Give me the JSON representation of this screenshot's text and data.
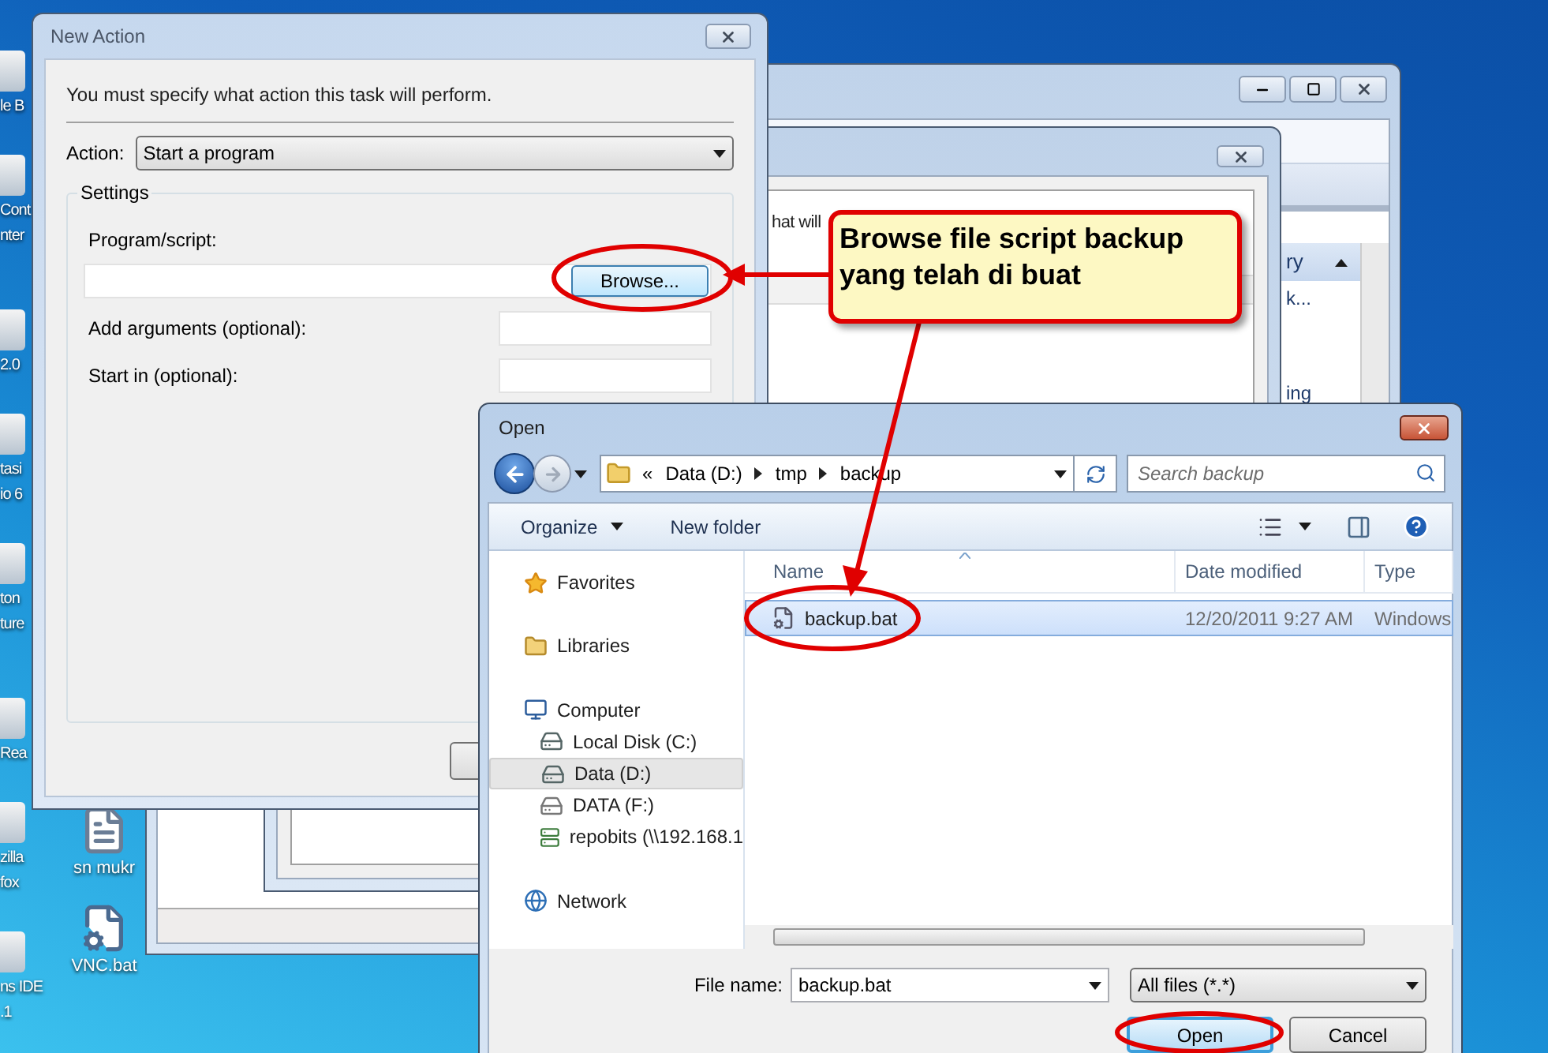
{
  "desktop": {
    "icons_left": [
      {
        "lines": [
          "le B"
        ]
      },
      {
        "lines": [
          "Cont",
          "nter"
        ]
      },
      {
        "lines": [
          "2.0"
        ]
      },
      {
        "lines": [
          "tasi",
          "io 6"
        ]
      },
      {
        "lines": [
          "ton",
          "ture"
        ]
      },
      {
        "lines": [
          "Rea"
        ]
      },
      {
        "lines": [
          "zilla",
          "fox"
        ]
      },
      {
        "lines": [
          "ns IDE",
          ".1"
        ]
      }
    ],
    "icons_right": [
      {
        "label": "sn mukr",
        "kind": "document"
      },
      {
        "label": "VNC.bat",
        "kind": "shortcut"
      }
    ]
  },
  "back_window": {
    "pane_header": "ry",
    "pane_items": [
      "k...",
      "ing"
    ]
  },
  "middle_window": {
    "text_fragment": "hat will"
  },
  "new_action": {
    "title": "New Action",
    "instruction": "You must specify what action this task will perform.",
    "action_label": "Action:",
    "action_value": "Start a program",
    "settings_label": "Settings",
    "program_label": "Program/script:",
    "browse_button": "Browse...",
    "fields": [
      {
        "label": "Add arguments (optional):"
      },
      {
        "label": "Start in (optional):"
      }
    ]
  },
  "open_dialog": {
    "title": "Open",
    "breadcrumb_prefix": "«",
    "breadcrumb": [
      "Data (D:)",
      "tmp",
      "backup"
    ],
    "search": {
      "placeholder": "Search backup"
    },
    "toolbar": [
      {
        "label": "Organize",
        "dropdown": true
      },
      {
        "label": "New folder",
        "dropdown": false
      }
    ],
    "nav": [
      {
        "label": "Favorites",
        "kind": "star",
        "selected": false
      },
      {
        "label": "Libraries",
        "kind": "library",
        "selected": false
      },
      {
        "label": "Computer",
        "kind": "computer",
        "selected": false,
        "children": [
          {
            "label": "Local Disk (C:)",
            "kind": "disk",
            "selected": false
          },
          {
            "label": "Data (D:)",
            "kind": "disk",
            "selected": true
          },
          {
            "label": "DATA (F:)",
            "kind": "drive",
            "selected": false
          },
          {
            "label": "repobits (\\\\192.168.1",
            "kind": "netdrive",
            "selected": false
          }
        ]
      },
      {
        "label": "Network",
        "kind": "network",
        "selected": false
      }
    ],
    "columns": [
      "Name",
      "Date modified",
      "Type"
    ],
    "files": [
      {
        "name": "backup.bat",
        "date": "12/20/2011 9:27 AM",
        "type": "Windows",
        "selected": true
      }
    ],
    "file_name_label": "File name:",
    "file_name": "backup.bat",
    "filter": "All files (*.*)",
    "buttons": [
      {
        "label": "Open",
        "default": true
      },
      {
        "label": "Cancel",
        "default": false
      }
    ]
  },
  "callout": "Browse file script backup yang telah di buat"
}
